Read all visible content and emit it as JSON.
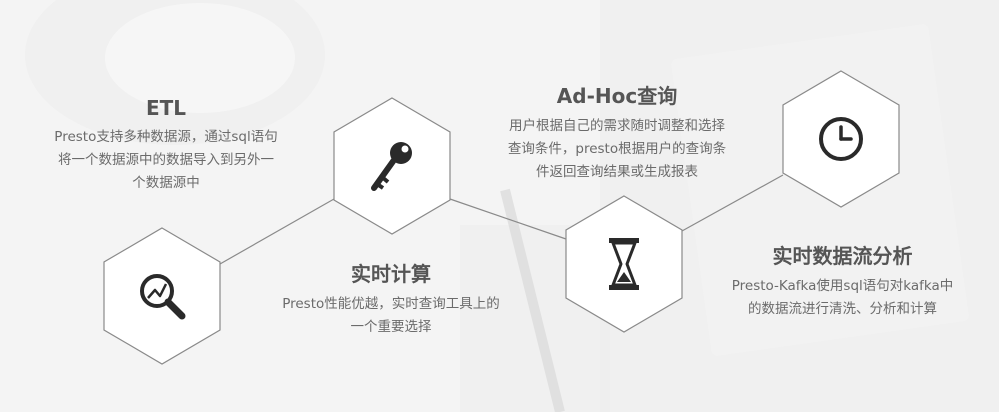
{
  "colors": {
    "hex_stroke": "#8a8a8a",
    "connector": "#8a8a8a",
    "hex_fill": "#ffffff",
    "icon": "#2a2a2a",
    "title_text": "#555555",
    "body_text": "#6b6b6b"
  },
  "sections": [
    {
      "id": "etl",
      "icon": "magnifier-chart-icon",
      "title": "ETL",
      "lines": [
        "Presto支持多种数据源，通过sql语句",
        "将一个数据源中的数据导入到另外一",
        "个数据源中"
      ]
    },
    {
      "id": "realtime-compute",
      "icon": "key-icon",
      "title": "实时计算",
      "lines": [
        "Presto性能优越，实时查询工具上的",
        "一个重要选择"
      ]
    },
    {
      "id": "adhoc",
      "icon": "hourglass-icon",
      "title": "Ad-Hoc查询",
      "lines": [
        "用户根据自己的需求随时调整和选择",
        "查询条件，presto根据用户的查询条",
        "件返回查询结果或生成报表"
      ]
    },
    {
      "id": "stream",
      "icon": "clock-icon",
      "title": "实时数据流分析",
      "lines": [
        "Presto-Kafka使用sql语句对kafka中",
        "的数据流进行清洗、分析和计算"
      ]
    }
  ]
}
